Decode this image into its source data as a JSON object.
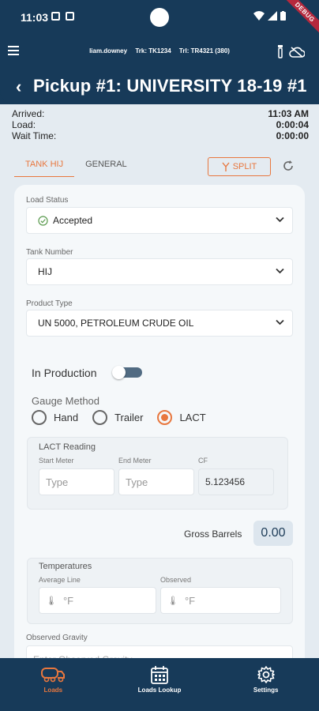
{
  "status_bar": {
    "time": "11:03",
    "debug_label": "DEBUG"
  },
  "header": {
    "user": "liam.downey",
    "truck": "Trk: TK1234",
    "trailer": "Trl: TR4321 (380)",
    "title": "Pickup #1: UNIVERSITY 18-19 #1"
  },
  "times": [
    {
      "label": "Arrived:",
      "value": "11:03 AM"
    },
    {
      "label": "Load:",
      "value": "0:00:04"
    },
    {
      "label": "Wait Time:",
      "value": "0:00:00"
    }
  ],
  "tabs": [
    {
      "label": "TANK HIJ"
    },
    {
      "label": "GENERAL"
    }
  ],
  "split_label": "SPLIT",
  "form": {
    "load_status": {
      "label": "Load Status",
      "value": "Accepted"
    },
    "tank_number": {
      "label": "Tank Number",
      "value": "HIJ"
    },
    "product_type": {
      "label": "Product Type",
      "value": "UN 5000, PETROLEUM CRUDE OIL"
    },
    "in_production": {
      "label": "In Production",
      "on": false
    },
    "gauge_method": {
      "label": "Gauge Method",
      "options": [
        "Hand",
        "Trailer",
        "LACT"
      ],
      "selected": "LACT"
    },
    "lact": {
      "title": "LACT Reading",
      "start_meter_label": "Start Meter",
      "start_meter_placeholder": "Type",
      "end_meter_label": "End Meter",
      "end_meter_placeholder": "Type",
      "cf_label": "CF",
      "cf_value": "5.123456"
    },
    "gross_barrels": {
      "label": "Gross Barrels",
      "value": "0.00"
    },
    "temperatures": {
      "title": "Temperatures",
      "average_line_label": "Average Line",
      "average_line_unit": "°F",
      "observed_label": "Observed",
      "observed_unit": "°F"
    },
    "observed_gravity": {
      "label": "Observed Gravity",
      "placeholder": "Enter Observed Gravity"
    }
  },
  "bottom_nav": [
    {
      "label": "Loads",
      "icon": "truck-icon",
      "active": true
    },
    {
      "label": "Loads Lookup",
      "icon": "calendar-icon",
      "active": false
    },
    {
      "label": "Settings",
      "icon": "gear-icon",
      "active": false
    }
  ],
  "colors": {
    "brand_navy": "#173a59",
    "accent_orange": "#e8773e",
    "background": "#e4ebf1"
  }
}
